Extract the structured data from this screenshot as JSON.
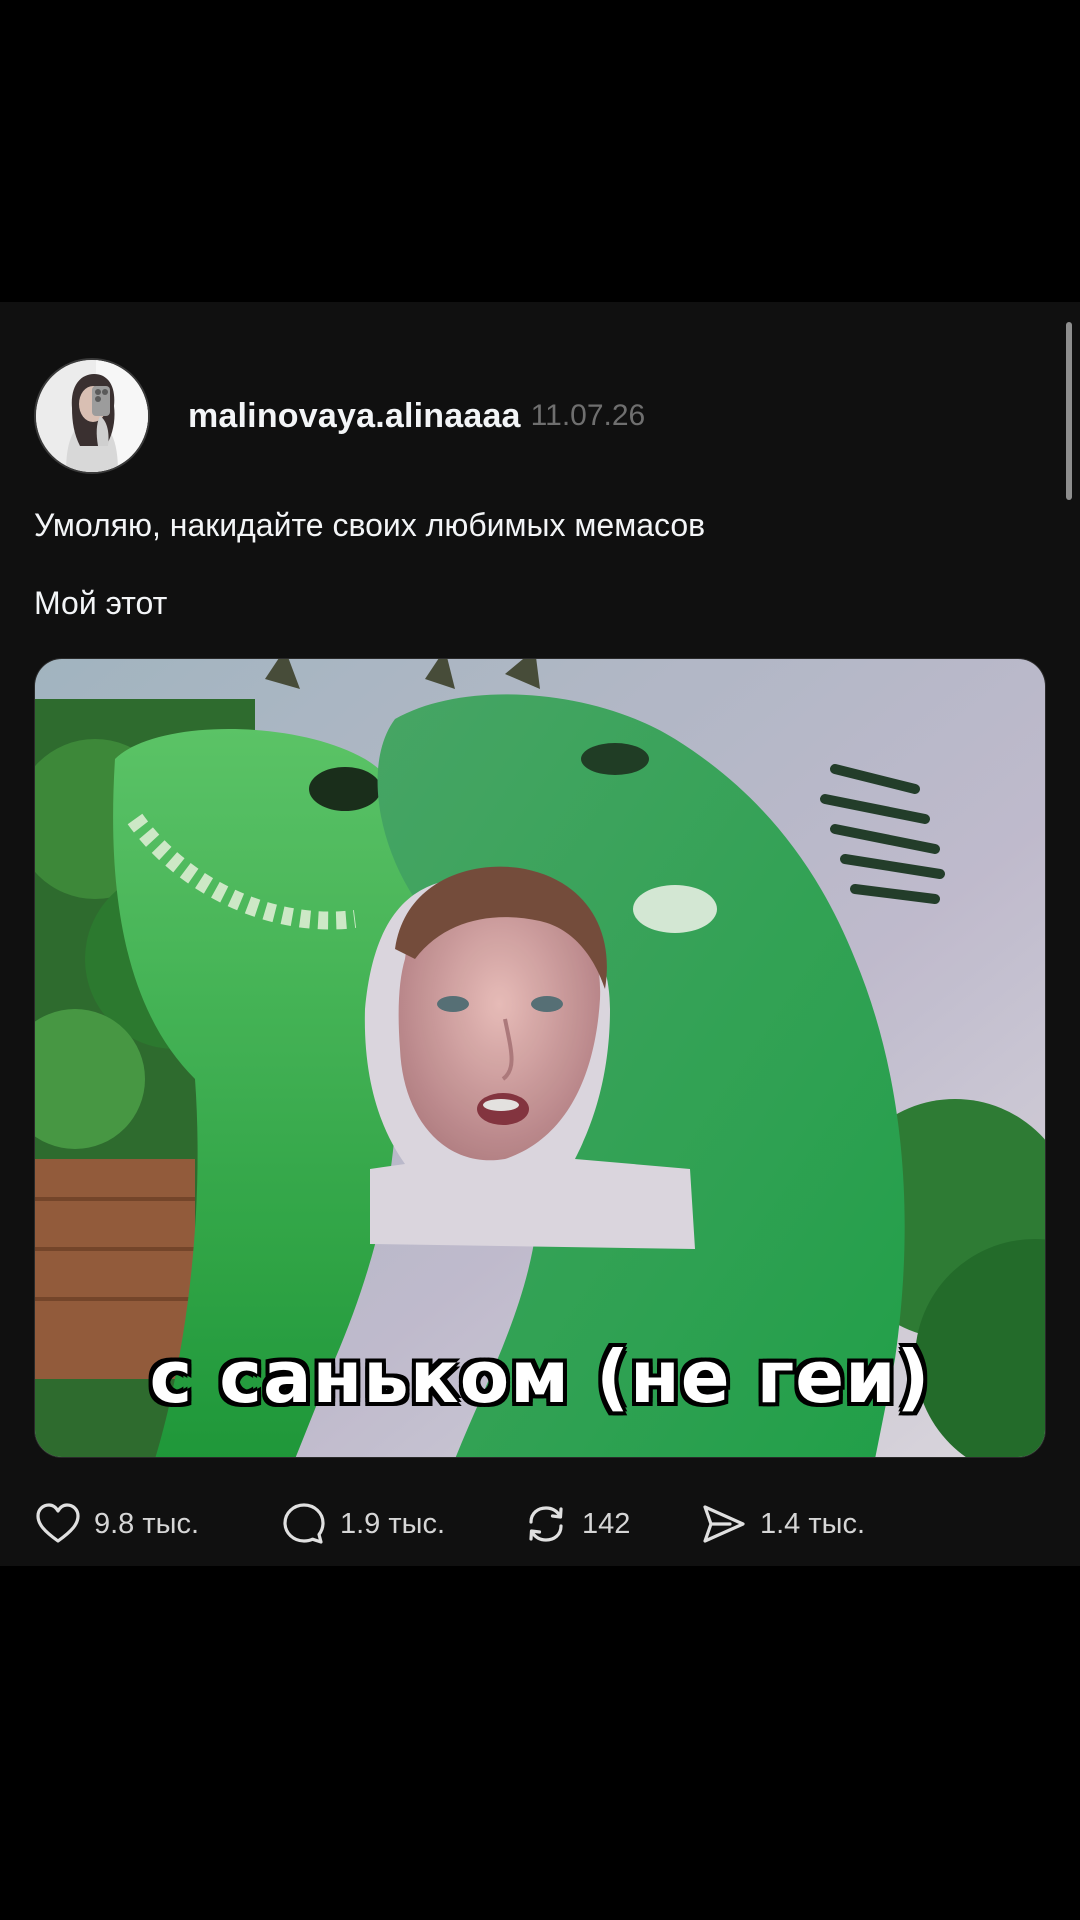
{
  "post": {
    "author": {
      "username": "malinovaya.alinaaaa",
      "avatar_icon": "profile-photo"
    },
    "date": "11.07.26",
    "text_lines": [
      "Умоляю, накидайте своих любимых мемасов",
      "Мой этот"
    ],
    "media": {
      "caption": "с саньком (не геи)"
    },
    "actions": {
      "likes": "9.8 тыс.",
      "comments": "1.9 тыс.",
      "reposts": "142",
      "shares": "1.4 тыс."
    }
  },
  "icons": {
    "like": "heart-icon",
    "comment": "comment-bubble-icon",
    "repost": "repost-icon",
    "share": "send-icon"
  },
  "colors": {
    "background": "#000000",
    "card": "#101010",
    "text": "#f3f5f7",
    "muted": "#6f6f6f"
  }
}
